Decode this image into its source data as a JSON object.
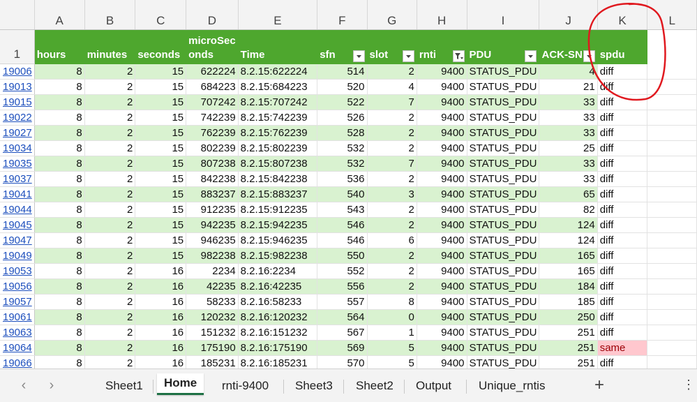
{
  "columns": [
    "A",
    "B",
    "C",
    "D",
    "E",
    "F",
    "G",
    "H",
    "I",
    "J",
    "K",
    "L"
  ],
  "header_row_number": "1",
  "headers": {
    "A": "hours",
    "B": "minutes",
    "C": "seconds",
    "D": "microSec onds",
    "E": "Time",
    "F": "sfn",
    "G": "slot",
    "H": "rnti",
    "I": "PDU",
    "J": "ACK-SN",
    "K": "spdu"
  },
  "rows": [
    {
      "n": "19006",
      "a": "8",
      "b": "2",
      "c": "15",
      "d": "622224",
      "e": "8.2.15:622224",
      "f": "514",
      "g": "2",
      "h": "9400",
      "i": "STATUS_PDU",
      "j": "4",
      "k": "diff"
    },
    {
      "n": "19013",
      "a": "8",
      "b": "2",
      "c": "15",
      "d": "684223",
      "e": "8.2.15:684223",
      "f": "520",
      "g": "4",
      "h": "9400",
      "i": "STATUS_PDU",
      "j": "21",
      "k": "diff"
    },
    {
      "n": "19015",
      "a": "8",
      "b": "2",
      "c": "15",
      "d": "707242",
      "e": "8.2.15:707242",
      "f": "522",
      "g": "7",
      "h": "9400",
      "i": "STATUS_PDU",
      "j": "33",
      "k": "diff"
    },
    {
      "n": "19022",
      "a": "8",
      "b": "2",
      "c": "15",
      "d": "742239",
      "e": "8.2.15:742239",
      "f": "526",
      "g": "2",
      "h": "9400",
      "i": "STATUS_PDU",
      "j": "33",
      "k": "diff"
    },
    {
      "n": "19027",
      "a": "8",
      "b": "2",
      "c": "15",
      "d": "762239",
      "e": "8.2.15:762239",
      "f": "528",
      "g": "2",
      "h": "9400",
      "i": "STATUS_PDU",
      "j": "33",
      "k": "diff"
    },
    {
      "n": "19034",
      "a": "8",
      "b": "2",
      "c": "15",
      "d": "802239",
      "e": "8.2.15:802239",
      "f": "532",
      "g": "2",
      "h": "9400",
      "i": "STATUS_PDU",
      "j": "25",
      "k": "diff"
    },
    {
      "n": "19035",
      "a": "8",
      "b": "2",
      "c": "15",
      "d": "807238",
      "e": "8.2.15:807238",
      "f": "532",
      "g": "7",
      "h": "9400",
      "i": "STATUS_PDU",
      "j": "33",
      "k": "diff"
    },
    {
      "n": "19037",
      "a": "8",
      "b": "2",
      "c": "15",
      "d": "842238",
      "e": "8.2.15:842238",
      "f": "536",
      "g": "2",
      "h": "9400",
      "i": "STATUS_PDU",
      "j": "33",
      "k": "diff"
    },
    {
      "n": "19041",
      "a": "8",
      "b": "2",
      "c": "15",
      "d": "883237",
      "e": "8.2.15:883237",
      "f": "540",
      "g": "3",
      "h": "9400",
      "i": "STATUS_PDU",
      "j": "65",
      "k": "diff"
    },
    {
      "n": "19044",
      "a": "8",
      "b": "2",
      "c": "15",
      "d": "912235",
      "e": "8.2.15:912235",
      "f": "543",
      "g": "2",
      "h": "9400",
      "i": "STATUS_PDU",
      "j": "82",
      "k": "diff"
    },
    {
      "n": "19045",
      "a": "8",
      "b": "2",
      "c": "15",
      "d": "942235",
      "e": "8.2.15:942235",
      "f": "546",
      "g": "2",
      "h": "9400",
      "i": "STATUS_PDU",
      "j": "124",
      "k": "diff"
    },
    {
      "n": "19047",
      "a": "8",
      "b": "2",
      "c": "15",
      "d": "946235",
      "e": "8.2.15:946235",
      "f": "546",
      "g": "6",
      "h": "9400",
      "i": "STATUS_PDU",
      "j": "124",
      "k": "diff"
    },
    {
      "n": "19049",
      "a": "8",
      "b": "2",
      "c": "15",
      "d": "982238",
      "e": "8.2.15:982238",
      "f": "550",
      "g": "2",
      "h": "9400",
      "i": "STATUS_PDU",
      "j": "165",
      "k": "diff"
    },
    {
      "n": "19053",
      "a": "8",
      "b": "2",
      "c": "16",
      "d": "2234",
      "e": "8.2.16:2234",
      "f": "552",
      "g": "2",
      "h": "9400",
      "i": "STATUS_PDU",
      "j": "165",
      "k": "diff"
    },
    {
      "n": "19056",
      "a": "8",
      "b": "2",
      "c": "16",
      "d": "42235",
      "e": "8.2.16:42235",
      "f": "556",
      "g": "2",
      "h": "9400",
      "i": "STATUS_PDU",
      "j": "184",
      "k": "diff"
    },
    {
      "n": "19057",
      "a": "8",
      "b": "2",
      "c": "16",
      "d": "58233",
      "e": "8.2.16:58233",
      "f": "557",
      "g": "8",
      "h": "9400",
      "i": "STATUS_PDU",
      "j": "185",
      "k": "diff"
    },
    {
      "n": "19061",
      "a": "8",
      "b": "2",
      "c": "16",
      "d": "120232",
      "e": "8.2.16:120232",
      "f": "564",
      "g": "0",
      "h": "9400",
      "i": "STATUS_PDU",
      "j": "250",
      "k": "diff"
    },
    {
      "n": "19063",
      "a": "8",
      "b": "2",
      "c": "16",
      "d": "151232",
      "e": "8.2.16:151232",
      "f": "567",
      "g": "1",
      "h": "9400",
      "i": "STATUS_PDU",
      "j": "251",
      "k": "diff"
    },
    {
      "n": "19064",
      "a": "8",
      "b": "2",
      "c": "16",
      "d": "175190",
      "e": "8.2.16:175190",
      "f": "569",
      "g": "5",
      "h": "9400",
      "i": "STATUS_PDU",
      "j": "251",
      "k": "same",
      "highlight": "same"
    },
    {
      "n": "19066",
      "a": "8",
      "b": "2",
      "c": "16",
      "d": "185231",
      "e": "8.2.16:185231",
      "f": "570",
      "g": "5",
      "h": "9400",
      "i": "STATUS_PDU",
      "j": "251",
      "k": "diff"
    }
  ],
  "sheet_tabs": [
    "Sheet1",
    "Home",
    "rnti-9400",
    "Sheet3",
    "Sheet2",
    "Output",
    "Unique_rntis"
  ],
  "active_tab": "Home",
  "colors": {
    "header_green": "#4ea72e",
    "band_green": "#d9f2d0",
    "same_fill": "#ffc7ce",
    "same_text": "#9c0006",
    "annotation_red": "#e0191f",
    "row_link_blue": "#1d4fbd"
  },
  "icons": {
    "prev_sheet": "chevron-left-icon",
    "next_sheet": "chevron-right-icon",
    "add_sheet": "plus-icon",
    "more": "vertical-ellipsis-icon",
    "filter": "filter-dropdown-icon",
    "filter_active": "filter-funnel-icon"
  }
}
